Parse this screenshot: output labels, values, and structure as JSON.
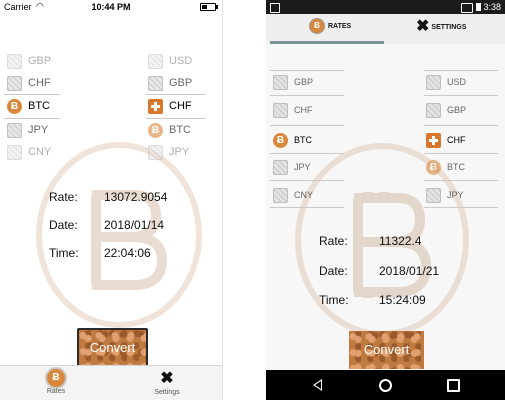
{
  "ios": {
    "status": {
      "carrier": "Carrier",
      "time": "10:44 PM"
    },
    "currencies_left": [
      {
        "code": "GBP",
        "icon": "gbp-flag-icon"
      },
      {
        "code": "CHF",
        "icon": "chf-flag-icon"
      },
      {
        "code": "BTC",
        "icon": "bitcoin-icon"
      },
      {
        "code": "JPY",
        "icon": "jpy-flag-icon"
      },
      {
        "code": "CNY",
        "icon": "cny-flag-icon"
      }
    ],
    "currencies_right": [
      {
        "code": "USD",
        "icon": "usd-flag-icon"
      },
      {
        "code": "GBP",
        "icon": "gbp-flag-icon"
      },
      {
        "code": "CHF",
        "icon": "chf-flag-icon"
      },
      {
        "code": "BTC",
        "icon": "bitcoin-icon"
      },
      {
        "code": "JPY",
        "icon": "jpy-flag-icon"
      }
    ],
    "info": {
      "rate_label": "Rate:",
      "rate_value": "13072.9054",
      "date_label": "Date:",
      "date_value": "2018/01/14",
      "time_label": "Time:",
      "time_value": "22:04:06"
    },
    "convert_label": "Convert",
    "tabs": [
      {
        "label": "Rates",
        "icon": "bitcoin-coin-icon"
      },
      {
        "label": "Settings",
        "icon": "tools-icon"
      }
    ]
  },
  "android": {
    "status": {
      "time": "3:38"
    },
    "tabs": [
      {
        "label": "RATES",
        "icon": "bitcoin-coin-icon"
      },
      {
        "label": "SETTINGS",
        "icon": "tools-icon"
      }
    ],
    "currencies_left": [
      {
        "code": "GBP",
        "icon": "gbp-flag-icon"
      },
      {
        "code": "CHF",
        "icon": "chf-flag-icon"
      },
      {
        "code": "BTC",
        "icon": "bitcoin-icon"
      },
      {
        "code": "JPY",
        "icon": "jpy-flag-icon"
      },
      {
        "code": "CNY",
        "icon": "cny-flag-icon"
      }
    ],
    "currencies_right": [
      {
        "code": "USD",
        "icon": "usd-flag-icon"
      },
      {
        "code": "GBP",
        "icon": "gbp-flag-icon"
      },
      {
        "code": "CHF",
        "icon": "chf-flag-icon"
      },
      {
        "code": "BTC",
        "icon": "bitcoin-icon"
      },
      {
        "code": "JPY",
        "icon": "jpy-flag-icon"
      }
    ],
    "info": {
      "rate_label": "Rate:",
      "rate_value": "11322.4",
      "date_label": "Date:",
      "date_value": "2018/01/21",
      "time_label": "Time:",
      "time_value": "15:24:09"
    },
    "convert_label": "Convert"
  },
  "colors": {
    "accent": "#d9873c",
    "tab_indicator": "#7d9096"
  }
}
